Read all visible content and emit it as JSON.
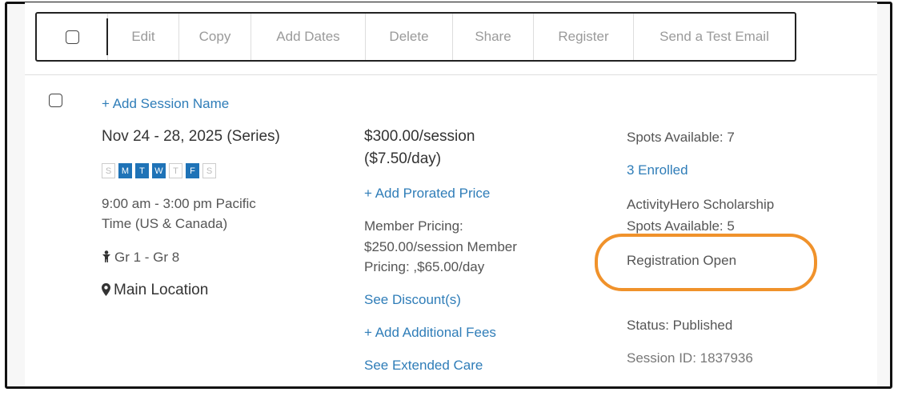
{
  "toolbar": {
    "buttons": [
      {
        "label": "Edit"
      },
      {
        "label": "Copy"
      },
      {
        "label": "Add Dates"
      },
      {
        "label": "Delete"
      },
      {
        "label": "Share"
      },
      {
        "label": "Register"
      },
      {
        "label": "Send a Test Email"
      }
    ]
  },
  "session": {
    "add_name_link": "+ Add Session Name",
    "dates": "Nov 24 - 28, 2025 (Series)",
    "days": [
      {
        "label": "S",
        "active": false
      },
      {
        "label": "M",
        "active": true
      },
      {
        "label": "T",
        "active": true
      },
      {
        "label": "W",
        "active": true
      },
      {
        "label": "T",
        "active": false
      },
      {
        "label": "F",
        "active": true
      },
      {
        "label": "S",
        "active": false
      }
    ],
    "time_line1": "9:00 am - 3:00 pm Pacific",
    "time_line2": "Time (US & Canada)",
    "grades": "Gr 1 - Gr 8",
    "location": "Main Location",
    "icons": {
      "grades": "child-icon",
      "location": "map-pin-icon"
    }
  },
  "pricing": {
    "price_line1": "$300.00/session",
    "price_line2": "($7.50/day)",
    "add_prorated_link": "+ Add Prorated Price",
    "member_line1": "Member Pricing:",
    "member_line2": "$250.00/session Member",
    "member_line3": "Pricing: ,$65.00/day",
    "see_discounts_link": "See Discount(s)",
    "add_fees_link": "+ Add Additional Fees",
    "see_extended_care_link": "See Extended Care"
  },
  "status": {
    "spots_available": "Spots Available: 7",
    "enrolled_link": "3 Enrolled",
    "scholarship_line1": "ActivityHero Scholarship",
    "scholarship_line2": "Spots Available: 5",
    "registration": "Registration Open",
    "status_text": "Status: Published",
    "session_id": "Session ID: 1837936"
  },
  "colors": {
    "link": "#2f7db8",
    "day_active": "#1f73b7",
    "highlight": "#f0922b"
  }
}
